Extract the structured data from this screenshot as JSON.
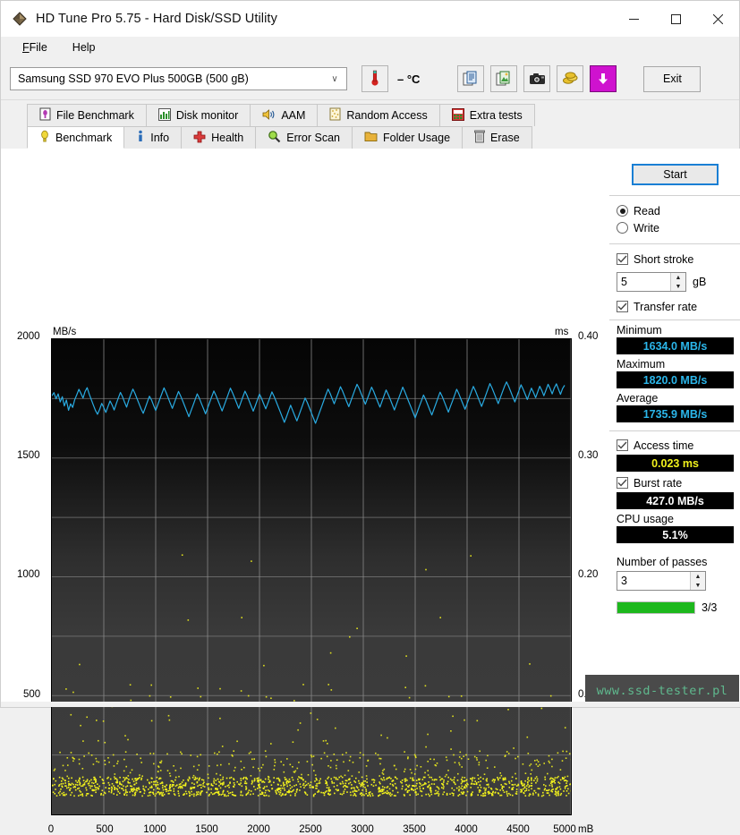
{
  "window": {
    "title": "HD Tune Pro 5.75 - Hard Disk/SSD Utility",
    "app_icon": "hdtune-diamond-icon",
    "minimize": "─",
    "maximize": "□",
    "close": "✕"
  },
  "menu": {
    "items": [
      {
        "label": "File",
        "accel": "F"
      },
      {
        "label": "Help",
        "accel": "H"
      }
    ]
  },
  "toolbar": {
    "device": "Samsung SSD 970 EVO Plus 500GB (500 gB)",
    "combo_arrow": "∨",
    "temperature": "– °C",
    "temp_icon": "thermometer-icon",
    "icons": [
      {
        "name": "copy-text-icon",
        "title": "Copy text"
      },
      {
        "name": "copy-image-icon",
        "title": "Copy image"
      },
      {
        "name": "screenshot-camera-icon",
        "title": "Screenshot"
      },
      {
        "name": "coins-icon",
        "title": "Donate"
      },
      {
        "name": "download-arrow-icon",
        "title": "Download"
      }
    ],
    "exit_label": "Exit"
  },
  "tabs": {
    "row1": [
      {
        "label": "File Benchmark",
        "icon": "file-benchmark-icon",
        "active": false
      },
      {
        "label": "Disk monitor",
        "icon": "disk-monitor-icon",
        "active": false
      },
      {
        "label": "AAM",
        "icon": "speaker-icon",
        "active": false
      },
      {
        "label": "Random Access",
        "icon": "random-access-icon",
        "active": false
      },
      {
        "label": "Extra tests",
        "icon": "extra-tests-icon",
        "active": false
      }
    ],
    "row2": [
      {
        "label": "Benchmark",
        "icon": "benchmark-bulb-icon",
        "active": true
      },
      {
        "label": "Info",
        "icon": "info-icon",
        "active": false
      },
      {
        "label": "Health",
        "icon": "health-cross-icon",
        "active": false
      },
      {
        "label": "Error Scan",
        "icon": "magnifier-icon",
        "active": false
      },
      {
        "label": "Folder Usage",
        "icon": "folder-icon",
        "active": false
      },
      {
        "label": "Erase",
        "icon": "trash-icon",
        "active": false
      }
    ]
  },
  "panel": {
    "start_label": "Start",
    "mode": {
      "read_label": "Read",
      "write_label": "Write",
      "selected": "Read"
    },
    "short_stroke": {
      "label": "Short stroke",
      "checked": true,
      "value": "5",
      "unit": "gB"
    },
    "transfer_rate": {
      "label": "Transfer rate",
      "checked": true
    },
    "minimum": {
      "label": "Minimum",
      "value": "1634.0 MB/s"
    },
    "maximum": {
      "label": "Maximum",
      "value": "1820.0 MB/s"
    },
    "average": {
      "label": "Average",
      "value": "1735.9 MB/s"
    },
    "access_time": {
      "label": "Access time",
      "checked": true,
      "value": "0.023 ms"
    },
    "burst_rate": {
      "label": "Burst rate",
      "checked": true,
      "value": "427.0 MB/s"
    },
    "cpu_usage": {
      "label": "CPU usage",
      "value": "5.1%"
    },
    "passes": {
      "label": "Number of passes",
      "value": "3"
    },
    "progress": {
      "text": "3/3",
      "percent": 100
    }
  },
  "watermark": "www.ssd-tester.pl",
  "colors": {
    "transfer_line": "#29abe2",
    "access_dots": "#f2f21c",
    "accent_blue": "#1a7fd4",
    "progress_green": "#1db81d",
    "plot_bg_top": "#050505",
    "plot_bg_bottom": "#3d3d3d"
  },
  "chart_data": {
    "type": "line",
    "title": "",
    "xlabel": "mB",
    "ylabel": "MB/s",
    "y2label": "ms",
    "xlim": [
      0,
      5000
    ],
    "ylim": [
      0,
      2000
    ],
    "y2lim": [
      0,
      0.4
    ],
    "grid": true,
    "xticks": [
      0,
      500,
      1000,
      1500,
      2000,
      2500,
      3000,
      3500,
      4000,
      4500,
      5000
    ],
    "xtick_labels": [
      "0",
      "500",
      "1000",
      "1500",
      "2000",
      "2500",
      "3000",
      "3500",
      "4000",
      "4500",
      "5000"
    ],
    "yticks": [
      500,
      1000,
      1500,
      2000
    ],
    "ytick_labels": [
      "500",
      "1000",
      "1500",
      "2000"
    ],
    "y2ticks": [
      0.1,
      0.2,
      0.3,
      0.4
    ],
    "y2tick_labels": [
      "0.10",
      "0.20",
      "0.30",
      "0.40"
    ],
    "series": [
      {
        "name": "Transfer rate",
        "type": "line",
        "axis": "left",
        "unit": "MB/s",
        "color": "#29abe2",
        "summary": {
          "minimum": 1634.0,
          "maximum": 1820.0,
          "average": 1735.9
        },
        "x": [
          0,
          20,
          40,
          60,
          80,
          100,
          120,
          140,
          160,
          180,
          200,
          220,
          240,
          260,
          280,
          300,
          320,
          340,
          360,
          380,
          400,
          420,
          440,
          460,
          480,
          500,
          520,
          540,
          560,
          580,
          600,
          620,
          640,
          660,
          680,
          700,
          720,
          740,
          760,
          780,
          800,
          820,
          840,
          860,
          880,
          900,
          920,
          940,
          960,
          980,
          1000,
          1020,
          1040,
          1060,
          1080,
          1100,
          1120,
          1140,
          1160,
          1180,
          1200,
          1220,
          1240,
          1260,
          1280,
          1300,
          1320,
          1340,
          1360,
          1380,
          1400,
          1420,
          1440,
          1460,
          1480,
          1500,
          1520,
          1540,
          1560,
          1580,
          1600,
          1620,
          1640,
          1660,
          1680,
          1700,
          1720,
          1740,
          1760,
          1780,
          1800,
          1820,
          1840,
          1860,
          1880,
          1900,
          1920,
          1940,
          1960,
          1980,
          2000,
          2020,
          2040,
          2060,
          2080,
          2100,
          2120,
          2140,
          2160,
          2180,
          2200,
          2220,
          2240,
          2260,
          2280,
          2300,
          2320,
          2340,
          2360,
          2380,
          2400,
          2420,
          2440,
          2460,
          2480,
          2500,
          2520,
          2540,
          2560,
          2580,
          2600,
          2620,
          2640,
          2660,
          2680,
          2700,
          2720,
          2740,
          2760,
          2780,
          2800,
          2820,
          2840,
          2860,
          2880,
          2900,
          2920,
          2940,
          2960,
          2980,
          3000,
          3020,
          3040,
          3060,
          3080,
          3100,
          3120,
          3140,
          3160,
          3180,
          3200,
          3220,
          3240,
          3260,
          3280,
          3300,
          3320,
          3340,
          3360,
          3380,
          3400,
          3420,
          3440,
          3460,
          3480,
          3500,
          3520,
          3540,
          3560,
          3580,
          3600,
          3620,
          3640,
          3660,
          3680,
          3700,
          3720,
          3740,
          3760,
          3780,
          3800,
          3820,
          3840,
          3860,
          3880,
          3900,
          3920,
          3940,
          3960,
          3980,
          4000,
          4020,
          4040,
          4060,
          4080,
          4100,
          4120,
          4140,
          4160,
          4180,
          4200,
          4220,
          4240,
          4260,
          4280,
          4300,
          4320,
          4340,
          4360,
          4380,
          4400,
          4420,
          4440,
          4460,
          4480,
          4500,
          4520,
          4540,
          4560,
          4580,
          4600,
          4620,
          4640,
          4660,
          4680,
          4700,
          4720,
          4740,
          4760,
          4780,
          4800,
          4820,
          4840,
          4860,
          4880,
          4900,
          4920,
          4940,
          4960,
          4980,
          5000
        ],
        "y": [
          1762,
          1775,
          1749,
          1770,
          1736,
          1758,
          1719,
          1744,
          1701,
          1728,
          1713,
          1745,
          1766,
          1789,
          1771,
          1752,
          1780,
          1796,
          1768,
          1745,
          1722,
          1700,
          1684,
          1705,
          1730,
          1712,
          1692,
          1716,
          1740,
          1723,
          1702,
          1728,
          1752,
          1776,
          1758,
          1735,
          1714,
          1742,
          1768,
          1790,
          1772,
          1750,
          1728,
          1706,
          1688,
          1712,
          1736,
          1760,
          1744,
          1721,
          1700,
          1724,
          1748,
          1772,
          1795,
          1776,
          1754,
          1731,
          1709,
          1733,
          1757,
          1780,
          1762,
          1740,
          1718,
          1696,
          1674,
          1698,
          1722,
          1746,
          1770,
          1752,
          1730,
          1708,
          1686,
          1710,
          1734,
          1758,
          1782,
          1764,
          1742,
          1720,
          1698,
          1722,
          1746,
          1770,
          1794,
          1775,
          1753,
          1731,
          1709,
          1733,
          1757,
          1781,
          1763,
          1741,
          1719,
          1697,
          1721,
          1745,
          1769,
          1751,
          1729,
          1707,
          1730,
          1754,
          1778,
          1760,
          1738,
          1716,
          1694,
          1672,
          1650,
          1674,
          1698,
          1722,
          1700,
          1678,
          1656,
          1680,
          1704,
          1728,
          1752,
          1734,
          1712,
          1690,
          1668,
          1646,
          1670,
          1694,
          1718,
          1742,
          1766,
          1790,
          1772,
          1750,
          1728,
          1752,
          1776,
          1800,
          1782,
          1760,
          1738,
          1716,
          1740,
          1764,
          1788,
          1810,
          1792,
          1770,
          1748,
          1726,
          1750,
          1774,
          1798,
          1780,
          1758,
          1736,
          1714,
          1738,
          1762,
          1786,
          1768,
          1746,
          1724,
          1702,
          1726,
          1750,
          1774,
          1798,
          1779,
          1757,
          1735,
          1713,
          1691,
          1669,
          1693,
          1717,
          1741,
          1765,
          1747,
          1725,
          1703,
          1681,
          1705,
          1729,
          1753,
          1777,
          1759,
          1737,
          1715,
          1693,
          1717,
          1741,
          1765,
          1789,
          1771,
          1749,
          1727,
          1705,
          1729,
          1753,
          1777,
          1801,
          1783,
          1761,
          1739,
          1717,
          1741,
          1765,
          1789,
          1813,
          1795,
          1773,
          1751,
          1729,
          1753,
          1777,
          1801,
          1820,
          1802,
          1780,
          1758,
          1736,
          1760,
          1784,
          1808,
          1790,
          1768,
          1746,
          1770,
          1794,
          1776,
          1754,
          1778,
          1802,
          1784,
          1762,
          1786,
          1810,
          1792,
          1770,
          1794,
          1812,
          1790,
          1768,
          1792,
          1806
        ]
      },
      {
        "name": "Access time",
        "type": "scatter",
        "axis": "right",
        "unit": "ms",
        "color": "#f2f21c",
        "summary": {
          "average": 0.023
        },
        "note": "dense cluster near 0.018-0.030 ms across full range with sparse outliers up to ~0.22 ms",
        "cluster_range_ms": [
          0.016,
          0.032
        ],
        "outlier_max_ms": 0.225
      }
    ]
  }
}
